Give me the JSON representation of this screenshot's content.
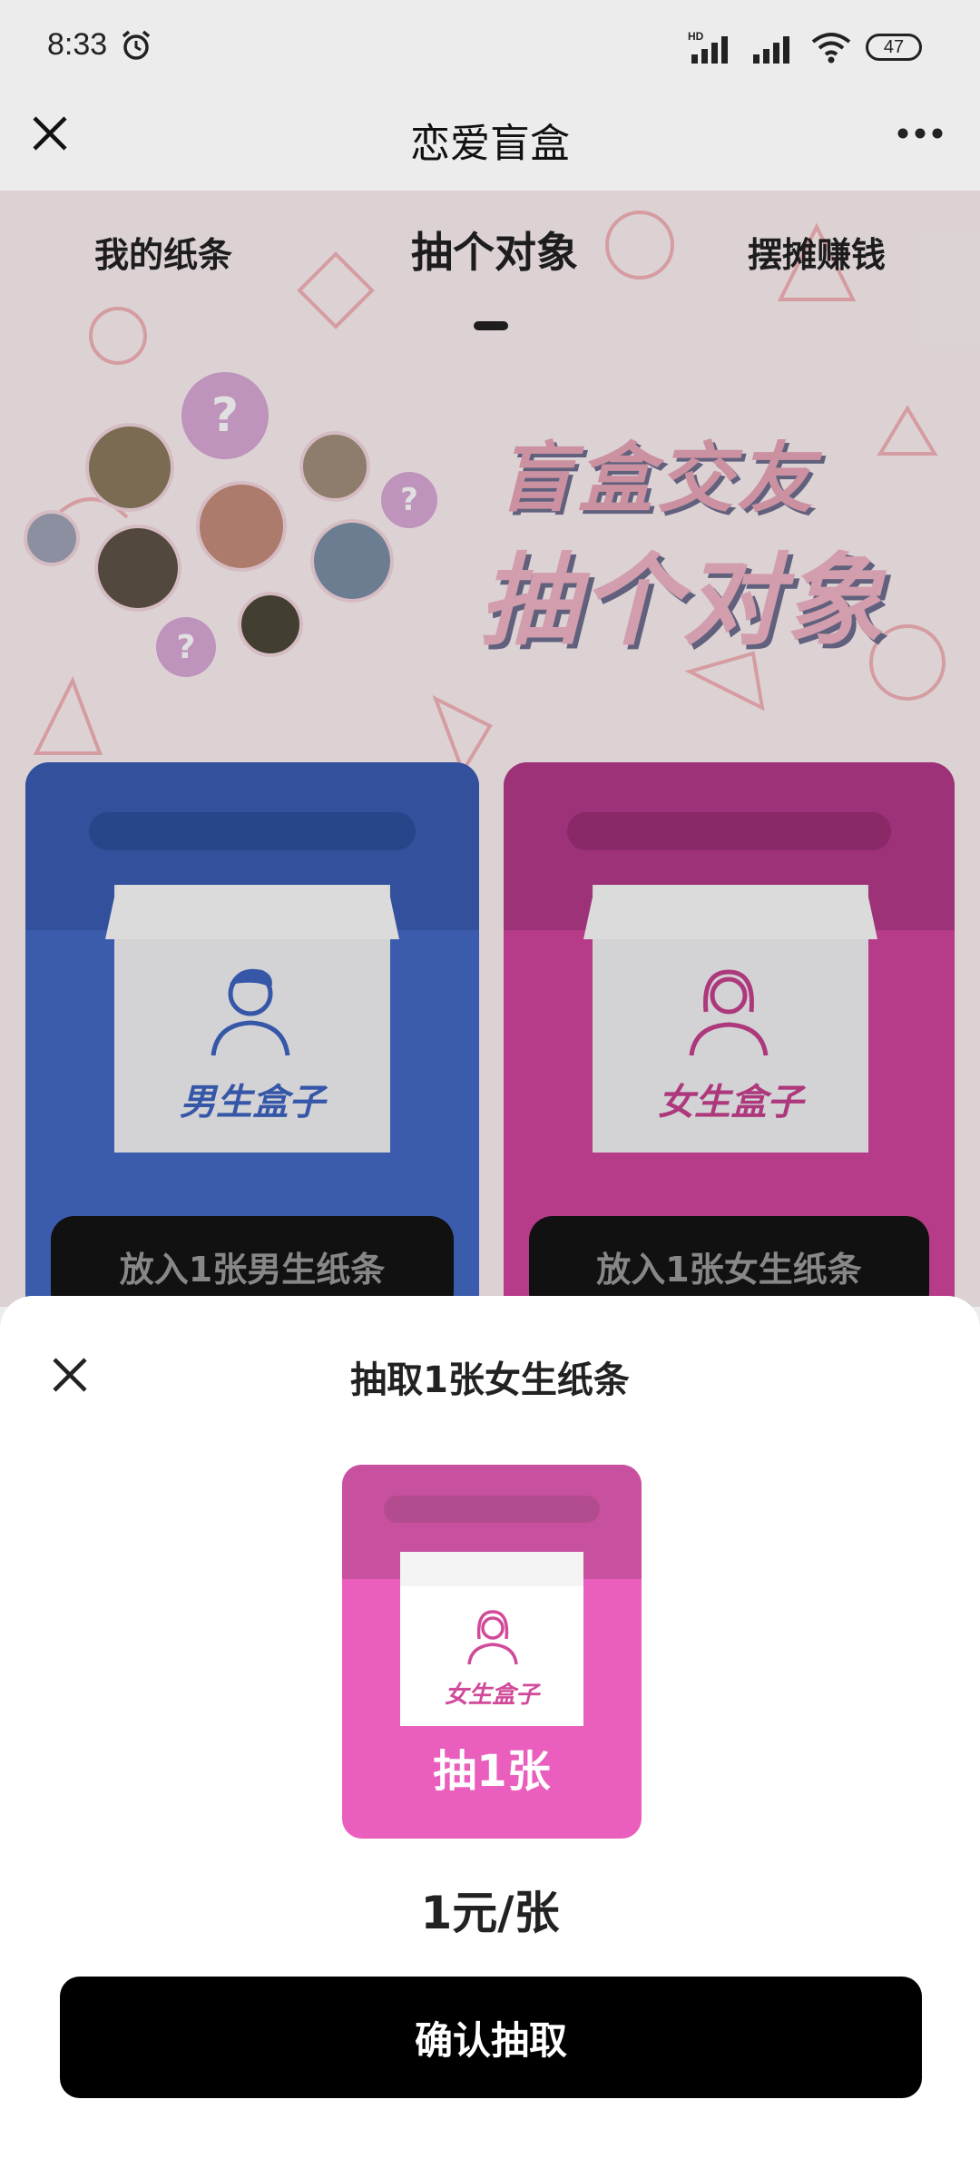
{
  "status_bar": {
    "time": "8:33",
    "network_label": "HD",
    "battery": "47"
  },
  "title_bar": {
    "title": "恋爱盲盒"
  },
  "tabs": [
    {
      "label": "我的纸条",
      "active": false
    },
    {
      "label": "抽个对象",
      "active": true
    },
    {
      "label": "摆摊赚钱",
      "active": false
    }
  ],
  "hero": {
    "line1": "盲盒交友",
    "line2": "抽个对象",
    "question_mark": "?"
  },
  "boxes": {
    "male": {
      "label": "男生盒子",
      "button": "放入1张男生纸条",
      "color": "#4468c4"
    },
    "female": {
      "label": "女生盒子",
      "button": "放入1张女生纸条",
      "color": "#d0449c"
    }
  },
  "sheet": {
    "title": "抽取1张女生纸条",
    "card_label": "女生盒子",
    "card_action": "抽1张",
    "price": "1元/张",
    "confirm": "确认抽取",
    "accent": "#ea5fbd"
  }
}
